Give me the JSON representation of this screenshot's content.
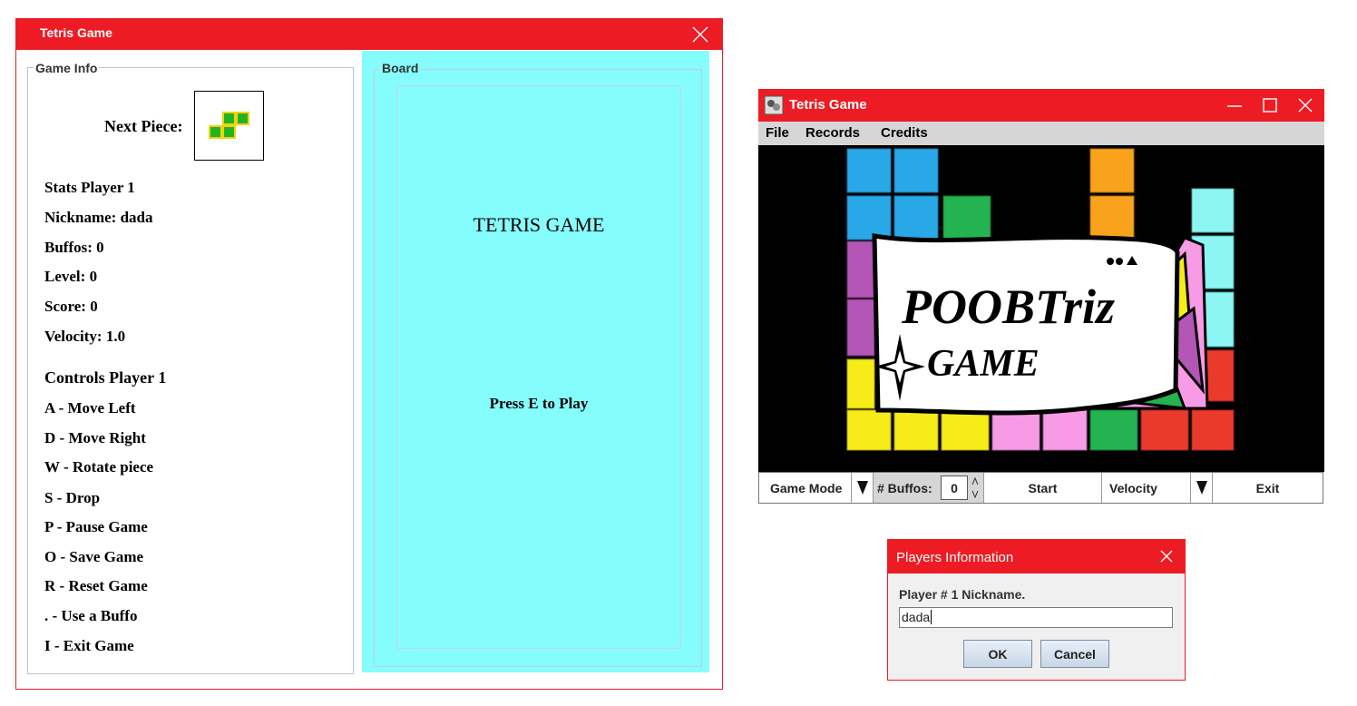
{
  "game_window": {
    "title": "Tetris Game",
    "info": {
      "legend": "Game Info",
      "next_piece_label": "Next Piece:",
      "stats_title": "Stats Player 1",
      "nickname": "Nickname: dada",
      "buffos": "Buffos: 0",
      "level": "Level: 0",
      "score": "Score: 0",
      "velocity": "Velocity: 1.0",
      "controls_title": "Controls Player 1",
      "controls": [
        "A - Move Left",
        "D - Move Right",
        "W - Rotate piece",
        "S - Drop",
        "P - Pause Game",
        "O - Save Game",
        "R - Reset Game",
        ". - Use a Buffo",
        "I - Exit Game"
      ]
    },
    "board": {
      "legend": "Board",
      "title": "TETRIS GAME",
      "prompt": "Press E to Play",
      "background": "#86fdfd"
    }
  },
  "menu_window": {
    "title": "Tetris Game",
    "menus": [
      "File",
      "Records",
      "Credits"
    ],
    "banner": {
      "title": "POOBTriz",
      "subtitle": "GAME"
    },
    "controls": {
      "game_mode": "Game Mode",
      "buffos_label": "# Buffos:",
      "buffos_value": "0",
      "start": "Start",
      "velocity": "Velocity",
      "exit": "Exit"
    }
  },
  "dialog": {
    "title": "Players Information",
    "label": "Player # 1 Nickname.",
    "input_value": "dada",
    "ok": "OK",
    "cancel": "Cancel"
  },
  "colors": {
    "title_bar": "#ed1c24",
    "board": "#86fdfd",
    "piece_fill": "#22b322",
    "piece_border": "#f2d20f"
  }
}
